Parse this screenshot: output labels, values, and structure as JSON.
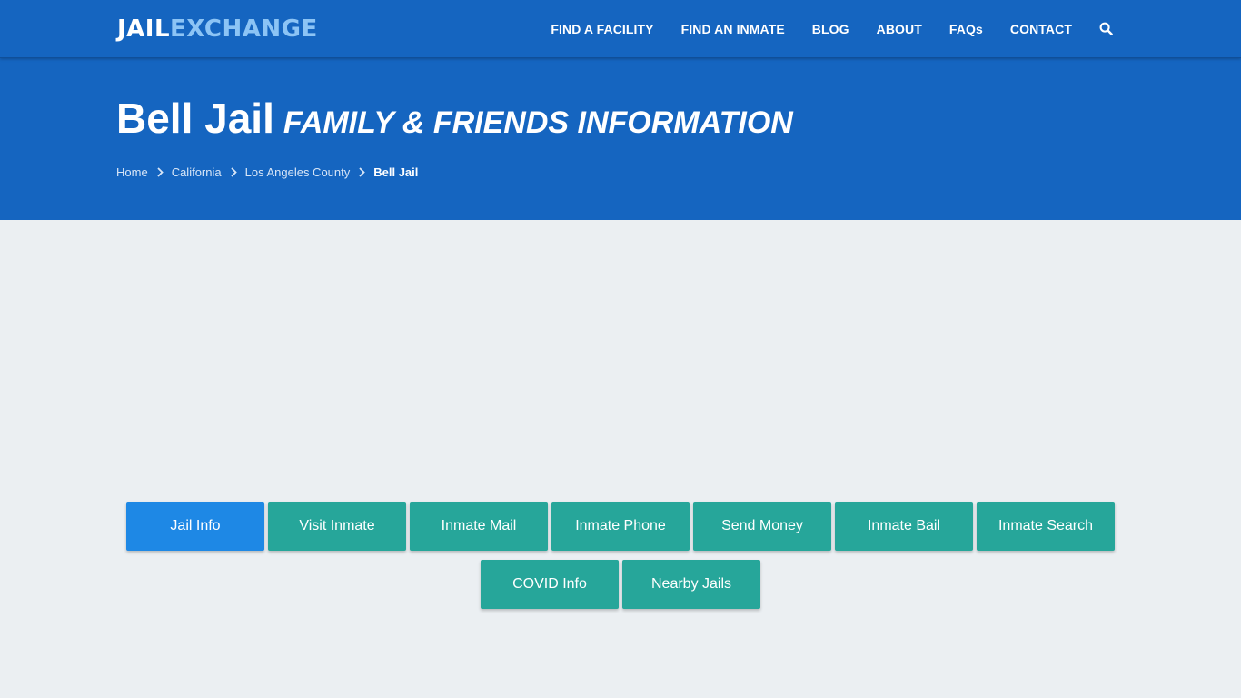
{
  "header": {
    "logo_part1": "JAIL",
    "logo_part2": "EXCHANGE",
    "nav": [
      {
        "label": "FIND A FACILITY"
      },
      {
        "label": "FIND AN INMATE"
      },
      {
        "label": "BLOG"
      },
      {
        "label": "ABOUT"
      },
      {
        "label": "FAQs"
      },
      {
        "label": "CONTACT"
      }
    ],
    "search_icon": "search-icon"
  },
  "hero": {
    "title": "Bell Jail",
    "subtitle": "FAMILY & FRIENDS INFORMATION",
    "breadcrumbs": [
      {
        "label": "Home"
      },
      {
        "label": "California"
      },
      {
        "label": "Los Angeles County"
      },
      {
        "label": "Bell Jail"
      }
    ]
  },
  "tabs": {
    "row1": [
      {
        "label": "Jail Info"
      },
      {
        "label": "Visit Inmate"
      },
      {
        "label": "Inmate Mail"
      },
      {
        "label": "Inmate Phone"
      },
      {
        "label": "Send Money"
      },
      {
        "label": "Inmate Bail"
      },
      {
        "label": "Inmate Search"
      }
    ],
    "row2": [
      {
        "label": "COVID Info"
      },
      {
        "label": "Nearby Jails"
      }
    ],
    "active": "Jail Info"
  },
  "colors": {
    "header_blue": "#1565c0",
    "logo_accent": "#8cc4f5",
    "button_teal": "#26a69a",
    "button_active": "#1e88e5",
    "page_bg": "#ebeff2"
  }
}
